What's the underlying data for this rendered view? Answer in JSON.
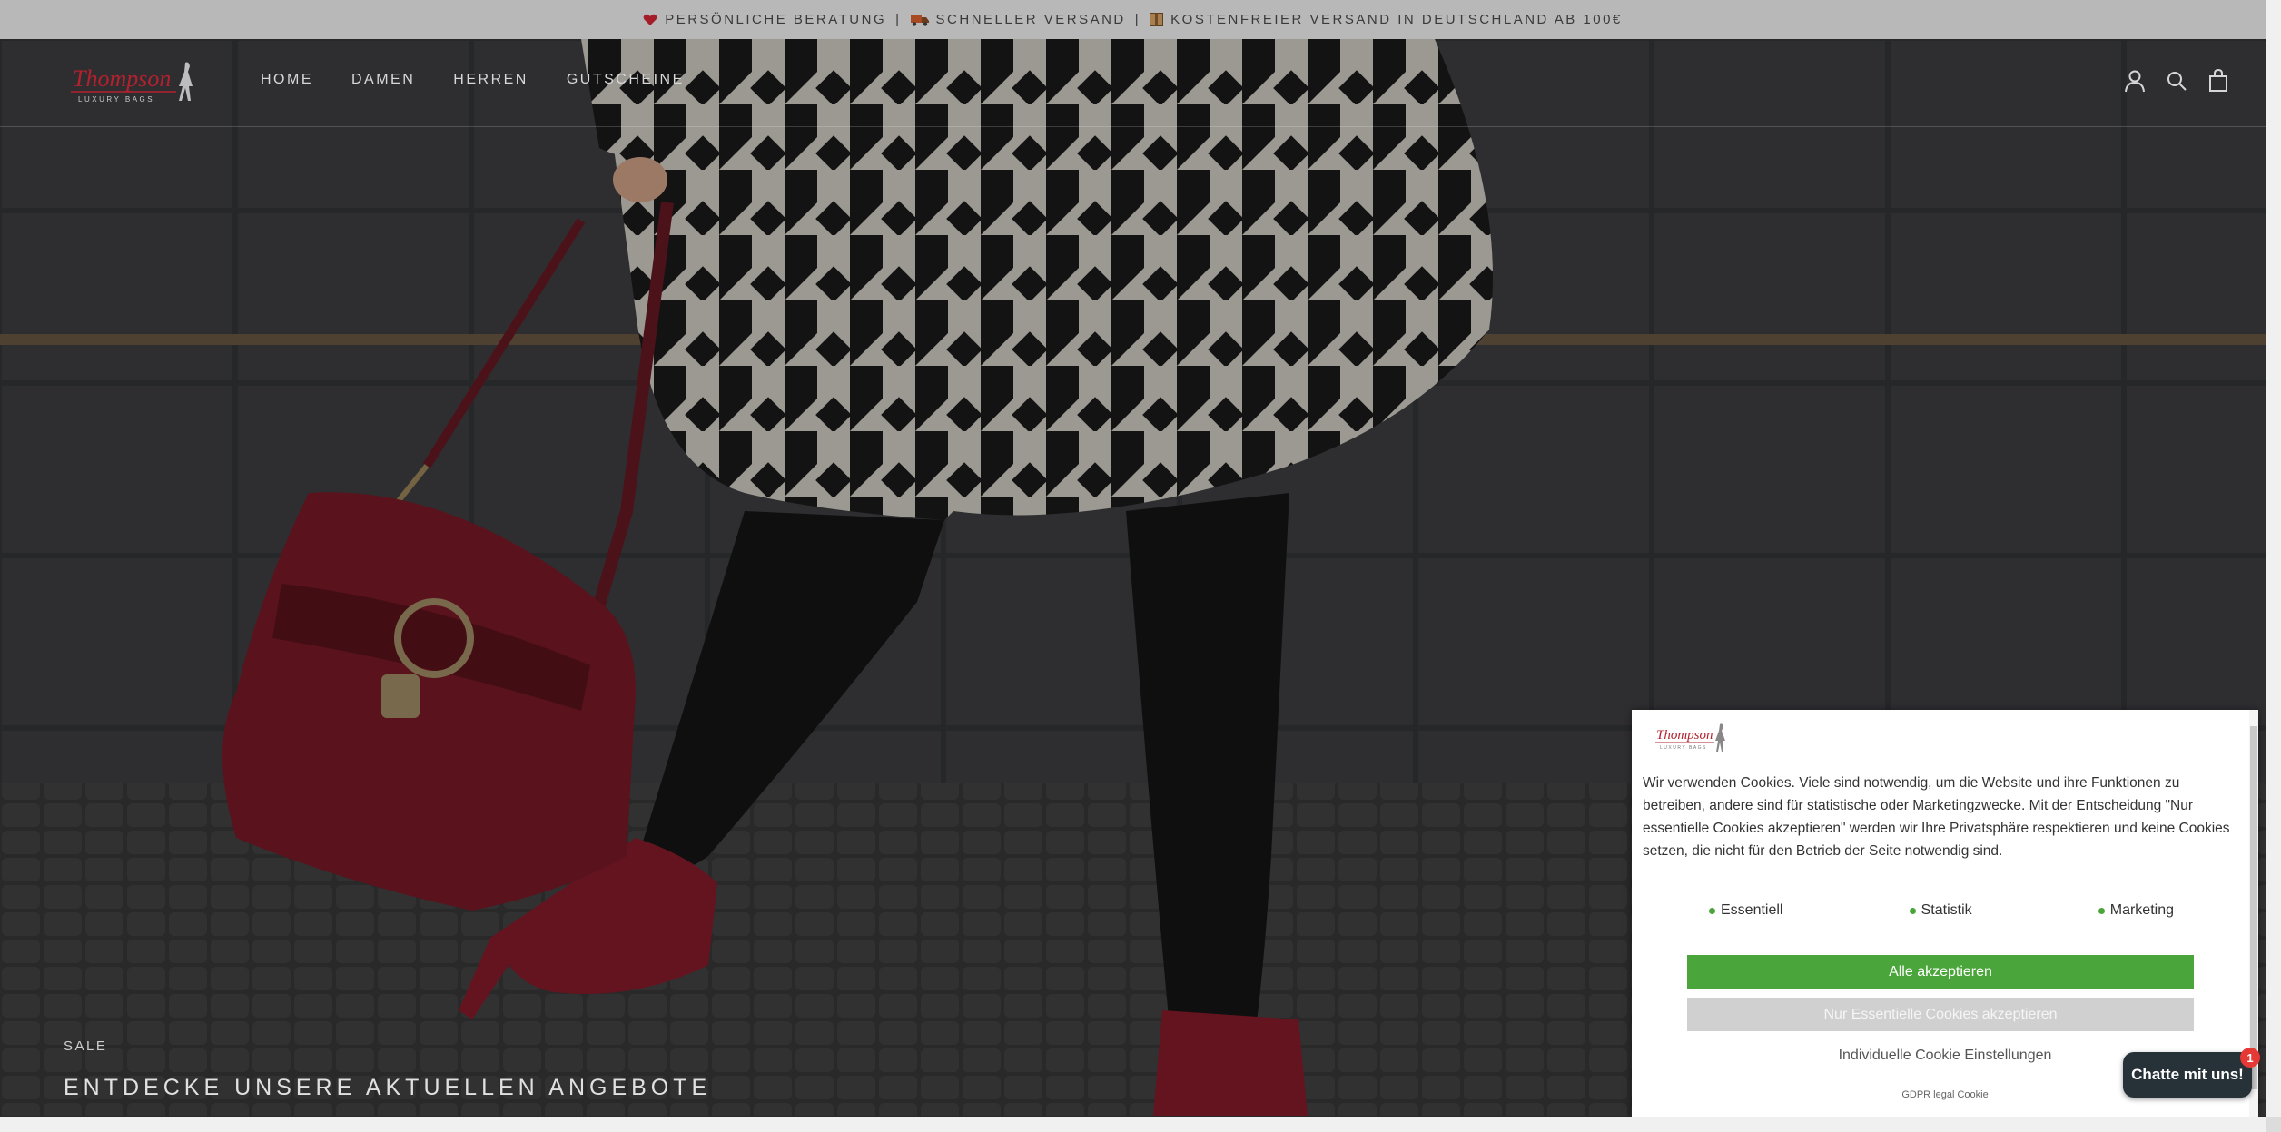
{
  "announcement": {
    "item1": "Persönliche Beratung",
    "item2": "Schneller Versand",
    "item3": "Kostenfreier Versand in Deutschland ab 100€",
    "separator": "|"
  },
  "header": {
    "logo_text": "Thompson",
    "logo_subtext": "LUXURY BAGS",
    "nav": [
      "HOME",
      "DAMEN",
      "HERREN",
      "GUTSCHEINE"
    ]
  },
  "hero": {
    "subtitle": "SALE",
    "title": "ENTDECKE UNSERE AKTUELLEN ANGEBOTE"
  },
  "cookie": {
    "logo_text": "Thompson",
    "logo_subtext": "LUXURY BAGS",
    "text": "Wir verwenden Cookies. Viele sind notwendig, um die Website und ihre Funktionen zu betreiben, andere sind für statistische oder Marketingzwecke. Mit der Entscheidung \"Nur essentielle Cookies akzeptieren\" werden wir Ihre Privatsphäre respektieren und keine Cookies setzen, die nicht für den Betrieb der Seite notwendig sind.",
    "categories": [
      "Essentiell",
      "Statistik",
      "Marketing"
    ],
    "accept_all": "Alle akzeptieren",
    "accept_essential": "Nur Essentielle Cookies akzeptieren",
    "individual_settings": "Individuelle Cookie Einstellungen",
    "gdpr_link": "GDPR legal Cookie",
    "accent_color": "#4aa53a"
  },
  "chat": {
    "label": "Chatte mit uns!",
    "badge": "1"
  },
  "icons": {
    "announce": [
      "heart-icon",
      "truck-icon",
      "package-icon"
    ],
    "header": [
      "account-icon",
      "search-icon",
      "cart-icon"
    ]
  }
}
